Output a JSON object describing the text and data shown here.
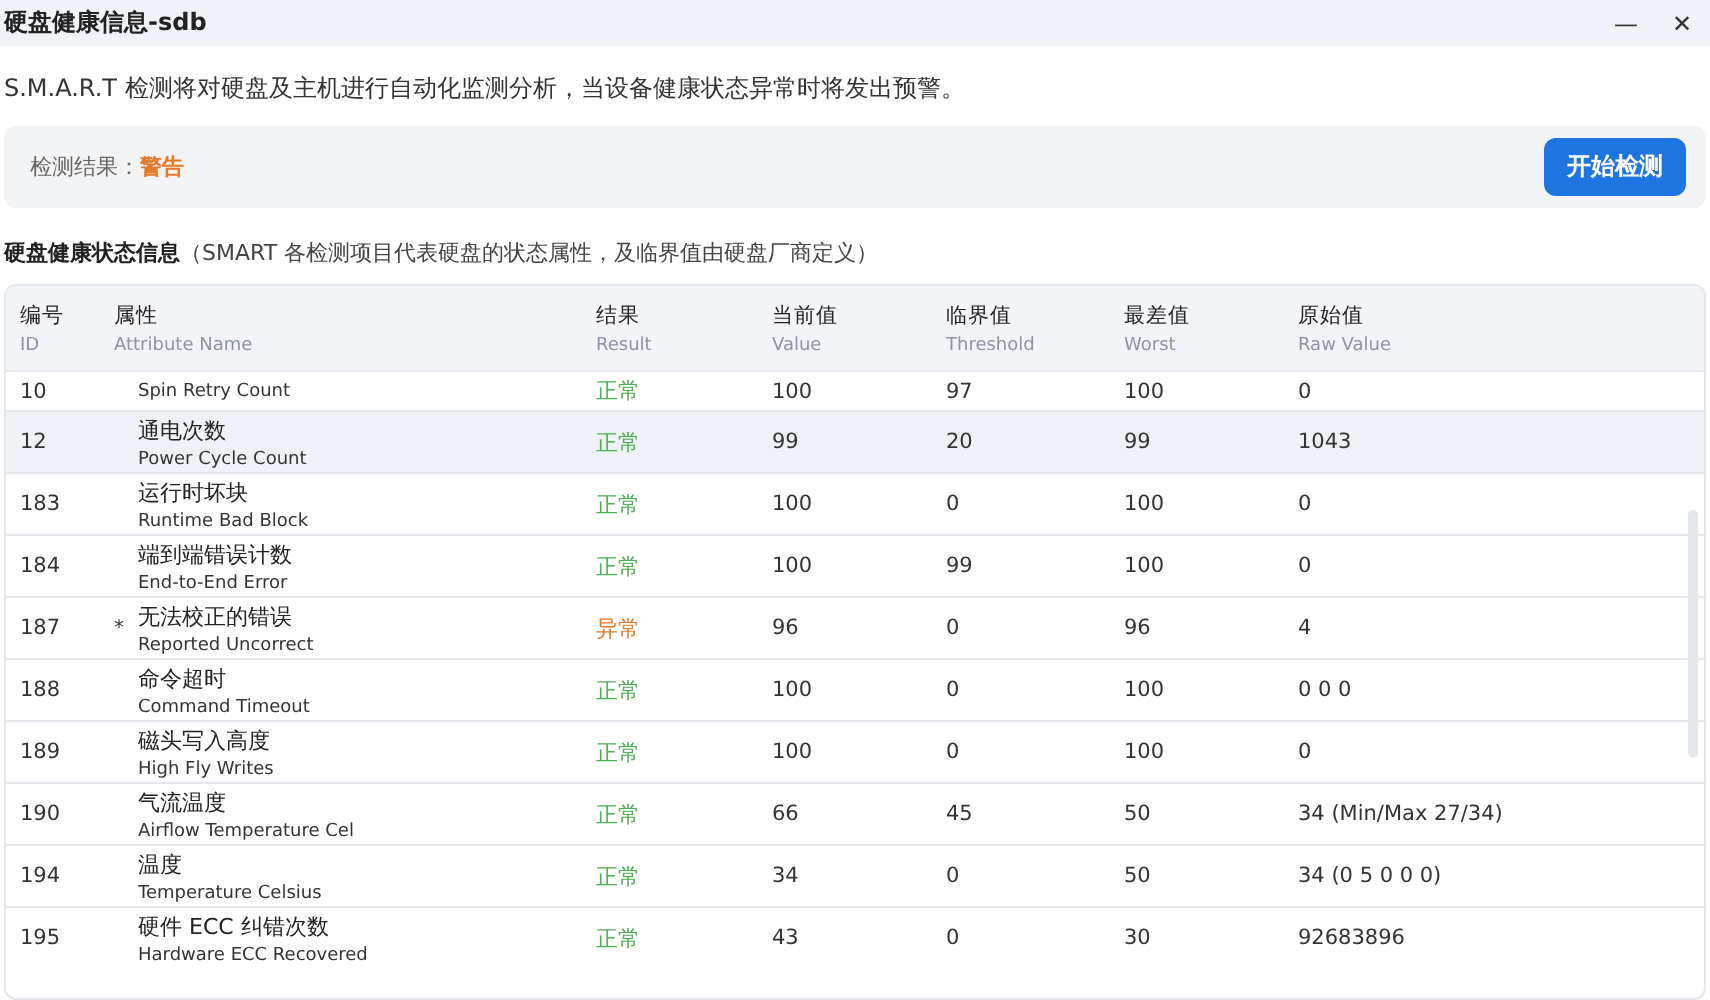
{
  "window": {
    "title": "硬盘健康信息-sdb",
    "controls": [
      "—",
      "✕"
    ]
  },
  "description": "S.M.A.R.T 检测将对硬盘及主机进行自动化监测分析，当设备健康状态异常时将发出预警。",
  "result": {
    "label": "检测结果：",
    "value": "警告",
    "kind": "warning",
    "button": "开始检测"
  },
  "section": {
    "title": "硬盘健康状态信息",
    "note": "（SMART 各检测项目代表硬盘的状态属性，及临界值由硬盘厂商定义）"
  },
  "table": {
    "columns": [
      {
        "zh": "编号",
        "en": "ID"
      },
      {
        "zh": "属性",
        "en": "Attribute Name"
      },
      {
        "zh": "结果",
        "en": "Result"
      },
      {
        "zh": "当前值",
        "en": "Value"
      },
      {
        "zh": "临界值",
        "en": "Threshold"
      },
      {
        "zh": "最差值",
        "en": "Worst"
      },
      {
        "zh": "原始值",
        "en": "Raw Value"
      }
    ],
    "rows": [
      {
        "id": "10",
        "name_en": "Spin Retry Count",
        "result": "正常",
        "kind": "normal",
        "value": "100",
        "threshold": "97",
        "worst": "100",
        "raw": "0",
        "selected": false,
        "partial": true
      },
      {
        "id": "12",
        "name_zh": "通电次数",
        "name_en": "Power Cycle Count",
        "result": "正常",
        "kind": "normal",
        "value": "99",
        "threshold": "20",
        "worst": "99",
        "raw": "1043",
        "selected": true,
        "partial": false
      },
      {
        "id": "183",
        "name_zh": "运行时坏块",
        "name_en": "Runtime Bad Block",
        "result": "正常",
        "kind": "normal",
        "value": "100",
        "threshold": "0",
        "worst": "100",
        "raw": "0",
        "selected": false,
        "partial": false
      },
      {
        "id": "184",
        "name_zh": "端到端错误计数",
        "name_en": "End-to-End Error",
        "result": "正常",
        "kind": "normal",
        "value": "100",
        "threshold": "99",
        "worst": "100",
        "raw": "0",
        "selected": false,
        "partial": false
      },
      {
        "id": "187",
        "marker": "*",
        "name_zh": "无法校正的错误",
        "name_en": "Reported Uncorrect",
        "result": "异常",
        "kind": "abnormal",
        "value": "96",
        "threshold": "0",
        "worst": "96",
        "raw": "4",
        "selected": false,
        "partial": false
      },
      {
        "id": "188",
        "name_zh": "命令超时",
        "name_en": "Command Timeout",
        "result": "正常",
        "kind": "normal",
        "value": "100",
        "threshold": "0",
        "worst": "100",
        "raw": "0 0 0",
        "selected": false,
        "partial": false
      },
      {
        "id": "189",
        "name_zh": "磁头写入高度",
        "name_en": "High Fly Writes",
        "result": "正常",
        "kind": "normal",
        "value": "100",
        "threshold": "0",
        "worst": "100",
        "raw": "0",
        "selected": false,
        "partial": false
      },
      {
        "id": "190",
        "name_zh": "气流温度",
        "name_en": "Airflow Temperature Cel",
        "result": "正常",
        "kind": "normal",
        "value": "66",
        "threshold": "45",
        "worst": "50",
        "raw": "34 (Min/Max 27/34)",
        "selected": false,
        "partial": false
      },
      {
        "id": "194",
        "name_zh": "温度",
        "name_en": "Temperature Celsius",
        "result": "正常",
        "kind": "normal",
        "value": "34",
        "threshold": "0",
        "worst": "50",
        "raw": "34 (0 5 0 0 0)",
        "selected": false,
        "partial": false
      },
      {
        "id": "195",
        "name_zh": "硬件 ECC 纠错次数",
        "name_en": "Hardware ECC Recovered",
        "result": "正常",
        "kind": "normal",
        "value": "43",
        "threshold": "0",
        "worst": "30",
        "raw": "92683896",
        "selected": false,
        "partial": false
      }
    ]
  }
}
